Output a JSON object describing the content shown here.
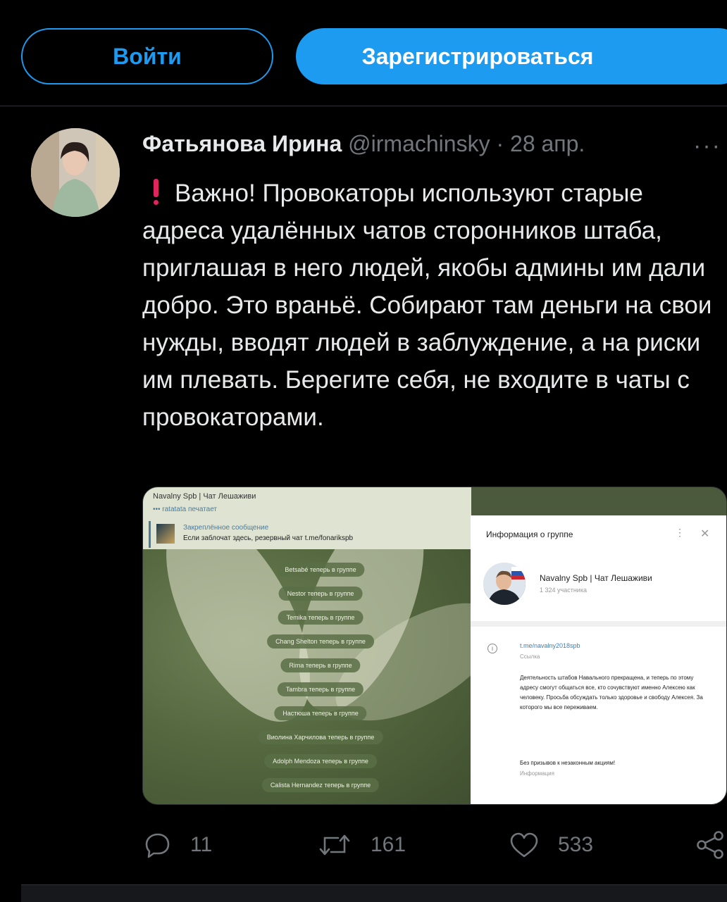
{
  "header": {
    "login_label": "Войти",
    "signup_label": "Зарегистрироваться"
  },
  "tweet": {
    "author_name": "Фатьянова Ирина",
    "handle": "@irmachinsky",
    "separator": "·",
    "date": "28 апр.",
    "more": "···",
    "text": "Важно! Провокаторы используют старые адреса удалённых чатов сторонников штаба, приглашая в него людей, якобы админы им дали добро. Это враньё. Собирают там деньги на свои нужды, вводят людей в заблуждение, а на риски им плевать. Берегите себя, не входите в чаты с провокаторами."
  },
  "media": {
    "chat_title": "Navalny Spb | Чат Лешаживи",
    "typing": "••• ratatata печатает",
    "pinned_title": "Закреплённое сообщение",
    "pinned_text": "Если заблочат здесь, резервный чат t.me/fonarikspb",
    "system_messages": [
      "Betsabé теперь в группе",
      "Nestor теперь в группе",
      "Temika теперь в группе",
      "Chang Shelton теперь в группе",
      "Rima теперь в группе",
      "Tambra теперь в группе",
      "Настюша теперь в группе",
      "Виолина Харчилова теперь в группе",
      "Adolph Mendoza теперь в группе",
      "Calista Hernandez теперь в группе"
    ],
    "info": {
      "title": "Информация о группе",
      "dots": "⋮",
      "close": "✕",
      "group_name": "Navalny Spb | Чат Лешаживи",
      "members": "1 324 участника",
      "link": "t.me/navalny2018spb",
      "link_caption": "Ссылка",
      "description": "Деятельность штабов Навального прекращена, и теперь по этому адресу смогут общаться все, кто сочувствуют именно Алексею как человеку. Просьба обсуждать только здоровье и свободу Алексея. За которого мы все переживаем.",
      "rule": "Без призывов к незаконным акциям!",
      "rule_caption": "Информация"
    }
  },
  "actions": {
    "replies": "11",
    "retweets": "161",
    "likes": "533"
  }
}
